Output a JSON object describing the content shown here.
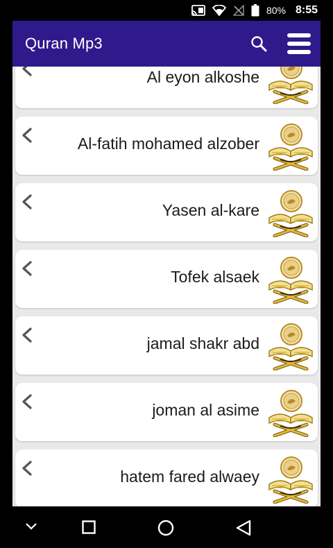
{
  "status_bar": {
    "battery": "80%",
    "time": "8:55"
  },
  "app_bar": {
    "title": "Quran Mp3"
  },
  "reciters": [
    {
      "name": "Al eyon alkoshe"
    },
    {
      "name": "Al-fatih mohamed alzober"
    },
    {
      "name": "Yasen al-kare"
    },
    {
      "name": "Tofek alsaek"
    },
    {
      "name": "jamal shakr abd"
    },
    {
      "name": "joman al asime"
    },
    {
      "name": "hatem fared alwaey"
    }
  ],
  "colors": {
    "app_bar": "#2f1a8c",
    "list_background": "#e9e9e9",
    "card": "#ffffff",
    "book_gold": "#c9a227"
  },
  "icons": {
    "search": "search-icon",
    "menu": "hamburger-menu-icon",
    "chevron": "chevron-left-icon",
    "quran": "open-quran-book-icon"
  }
}
